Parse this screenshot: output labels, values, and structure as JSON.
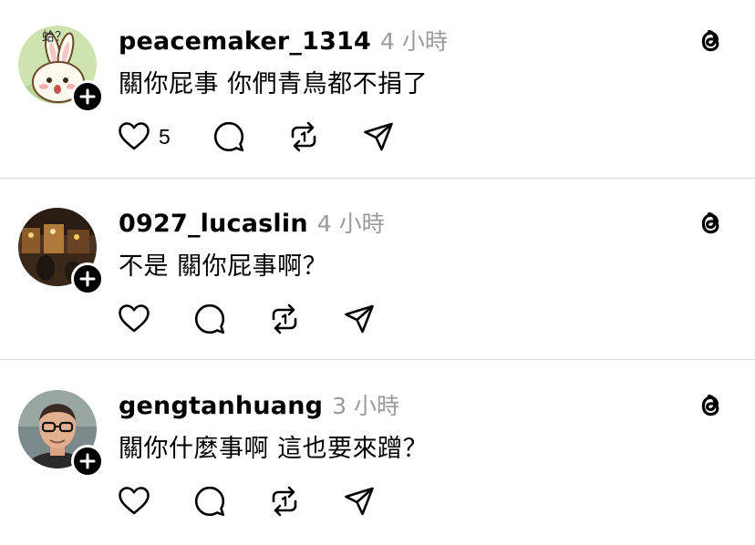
{
  "posts": [
    {
      "username": "peacemaker_1314",
      "time": "4 小時",
      "text": "關你屁事 你們青鳥都不捐了",
      "likes": "5",
      "avatar_caption": "蛤？",
      "avatar_icon": "rabbit-cartoon",
      "avatar_bg": "#cfe3b0"
    },
    {
      "username": "0927_lucaslin",
      "time": "4 小時",
      "text": "不是 關你屁事啊？",
      "likes": "",
      "avatar_icon": "photo-street-night",
      "avatar_bg": "#4a3320"
    },
    {
      "username": "gengtanhuang",
      "time": "3 小時",
      "text": "關你什麼事啊  這也要來蹭？",
      "likes": "",
      "avatar_icon": "photo-man-glasses",
      "avatar_bg": "#7a8a8a"
    }
  ],
  "icons": {
    "like": "heart-icon",
    "reply": "comment-icon",
    "repost": "repost-icon",
    "share": "send-icon",
    "brand": "threads-logo-icon",
    "follow": "plus-icon"
  }
}
